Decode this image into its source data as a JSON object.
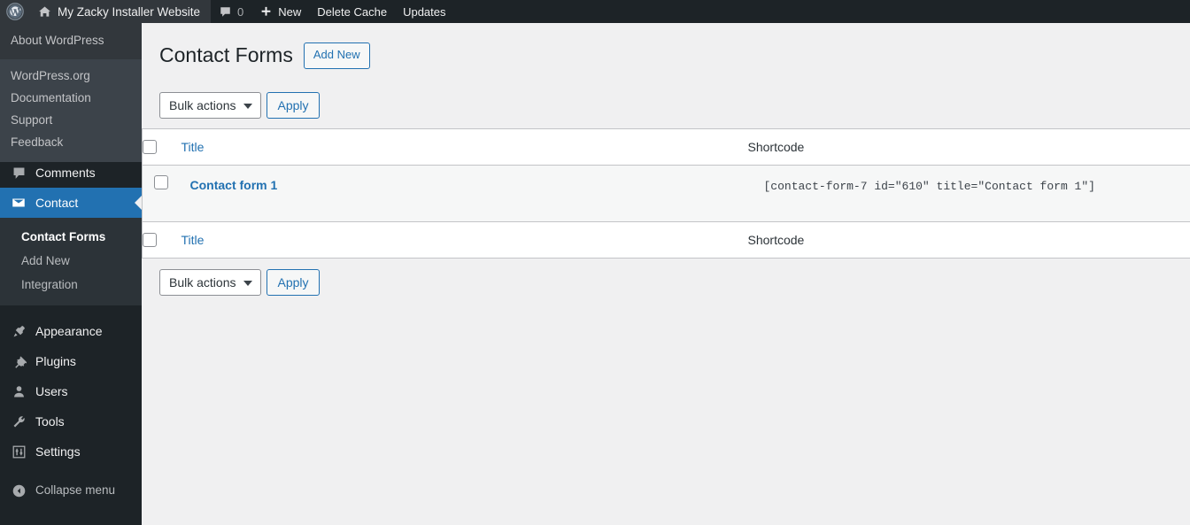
{
  "adminbar": {
    "logo_icon": "wordpress-logo-icon",
    "site_icon": "home-icon",
    "site_name": "My Zacky Installer Website",
    "comments_icon": "comment-bubble-icon",
    "comments_count": "0",
    "new_icon": "plus-icon",
    "new_label": "New",
    "delete_cache_label": "Delete Cache",
    "updates_label": "Updates"
  },
  "about_flyout": {
    "heading": "About WordPress",
    "links": [
      {
        "label": "WordPress.org"
      },
      {
        "label": "Documentation"
      },
      {
        "label": "Support"
      },
      {
        "label": "Feedback"
      }
    ]
  },
  "sidebar": {
    "items": [
      {
        "label": "Comments",
        "icon": "comment-bubble-icon",
        "current": false
      },
      {
        "label": "Contact",
        "icon": "envelope-icon",
        "current": true
      },
      {
        "label": "Appearance",
        "icon": "paintbrush-pin-icon",
        "current": false
      },
      {
        "label": "Plugins",
        "icon": "plug-icon",
        "current": false
      },
      {
        "label": "Users",
        "icon": "user-icon",
        "current": false
      },
      {
        "label": "Tools",
        "icon": "wrench-icon",
        "current": false
      },
      {
        "label": "Settings",
        "icon": "sliders-icon",
        "current": false
      },
      {
        "label": "Collapse menu",
        "icon": "arrow-left-circle-icon",
        "current": false
      }
    ],
    "submenu": [
      {
        "label": "Contact Forms",
        "current": true
      },
      {
        "label": "Add New",
        "current": false
      },
      {
        "label": "Integration",
        "current": false
      }
    ],
    "colors": {
      "background": "#1d2327",
      "submenu_background": "#2c3338",
      "current_accent": "#2271b1"
    }
  },
  "main": {
    "page_title": "Contact Forms",
    "add_new_label": "Add New",
    "bulk_top": {
      "selected": "Bulk actions",
      "apply_label": "Apply"
    },
    "bulk_bottom": {
      "selected": "Bulk actions",
      "apply_label": "Apply"
    },
    "table": {
      "columns": [
        {
          "key": "cb",
          "label": ""
        },
        {
          "key": "title",
          "label": "Title"
        },
        {
          "key": "shortcode",
          "label": "Shortcode"
        }
      ],
      "rows": [
        {
          "title": "Contact form 1",
          "shortcode": "[contact-form-7 id=\"610\" title=\"Contact form 1\"]"
        }
      ],
      "footer_columns": [
        {
          "key": "cb",
          "label": ""
        },
        {
          "key": "title",
          "label": "Title"
        },
        {
          "key": "shortcode",
          "label": "Shortcode"
        }
      ]
    }
  },
  "colors": {
    "link": "#2271b1",
    "page_background": "#f0f0f1",
    "table_background": "#ffffff",
    "row_background": "#f6f7f7"
  }
}
